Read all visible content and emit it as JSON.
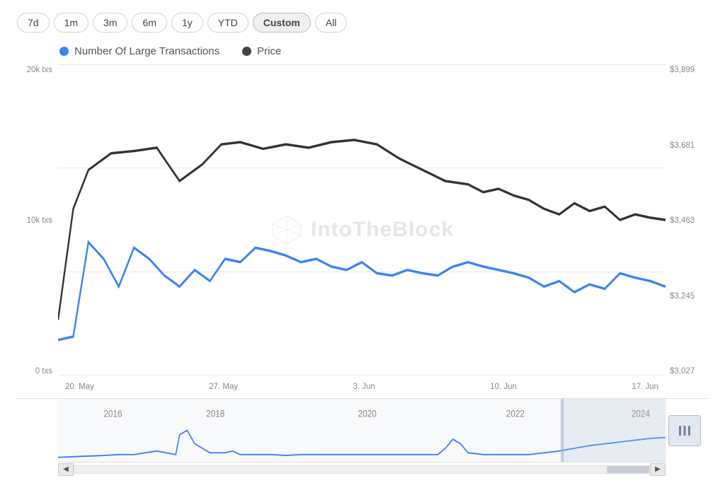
{
  "timeButtons": [
    {
      "label": "7d",
      "id": "7d",
      "active": false
    },
    {
      "label": "1m",
      "id": "1m",
      "active": false
    },
    {
      "label": "3m",
      "id": "3m",
      "active": false
    },
    {
      "label": "6m",
      "id": "6m",
      "active": false
    },
    {
      "label": "1y",
      "id": "1y",
      "active": false
    },
    {
      "label": "YTD",
      "id": "ytd",
      "active": false
    },
    {
      "label": "Custom",
      "id": "custom",
      "active": true
    },
    {
      "label": "All",
      "id": "all",
      "active": false
    }
  ],
  "legend": {
    "item1": {
      "label": "Number Of Large Transactions",
      "color": "blue"
    },
    "item2": {
      "label": "Price",
      "color": "dark"
    }
  },
  "yAxisLeft": [
    "20k txs",
    "10k txs",
    "0 txs"
  ],
  "yAxisRight": [
    "$3,899",
    "$3,681",
    "$3,463",
    "$3,245",
    "$3,027"
  ],
  "xAxisLabels": [
    "20. May",
    "27. May",
    "3. Jun",
    "10. Jun",
    "17. Jun"
  ],
  "miniChart": {
    "yearLabels": [
      "2016",
      "2018",
      "2020",
      "2022",
      "2024"
    ]
  },
  "watermark": "IntoTheBlock"
}
